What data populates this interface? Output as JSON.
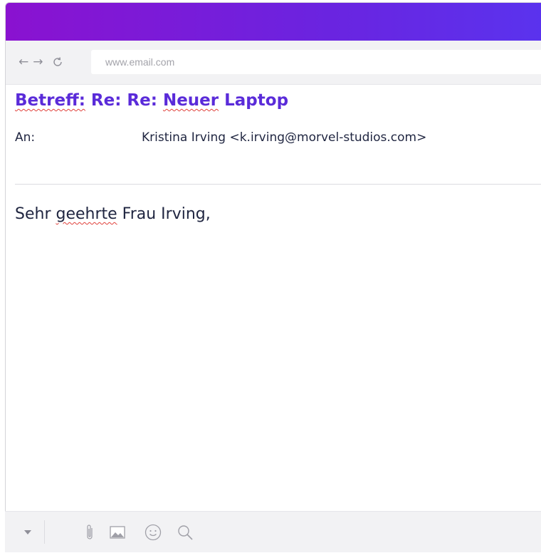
{
  "browser": {
    "url": "www.email.com",
    "nav_icons": [
      "back-arrow-icon",
      "forward-arrow-icon",
      "reload-icon"
    ]
  },
  "email": {
    "subject_prefix": "Betreff:",
    "subject_rest_1": " Re: Re: ",
    "subject_word": "Neuer",
    "subject_rest_2": " Laptop",
    "to_label": "An:",
    "to_value": "Kristina Irving <k.irving@morvel-studios.com>",
    "body_part_1": "Sehr ",
    "body_word": "geehrte",
    "body_part_2": " Frau Irving,"
  },
  "toolbar": {
    "icons": [
      "dropdown-caret-icon",
      "paperclip-icon",
      "image-icon",
      "emoji-icon",
      "search-icon"
    ]
  },
  "colors": {
    "accent": "#5a2bd9",
    "gradient_start": "#8a12d0",
    "gradient_end": "#5a33ee",
    "text": "#1f2540",
    "spellcheck": "#e0403a"
  }
}
